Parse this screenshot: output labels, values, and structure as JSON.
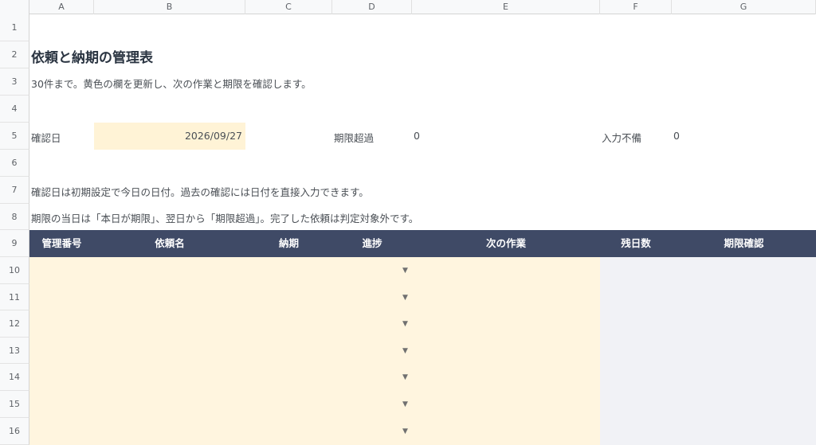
{
  "columns": [
    "A",
    "B",
    "C",
    "D",
    "E",
    "F",
    "G"
  ],
  "rows": [
    "1",
    "2",
    "3",
    "4",
    "5",
    "6",
    "7",
    "8",
    "9",
    "10",
    "11",
    "12",
    "13",
    "14",
    "15",
    "16"
  ],
  "title": "依頼と納期の管理表",
  "subtitle": "30件まで。黄色の欄を更新し、次の作業と期限を確認します。",
  "summary": {
    "check_date_label": "確認日",
    "check_date_value": "2026/09/27",
    "overdue_label": "期限超過",
    "overdue_value": "0",
    "missing_label": "入力不備",
    "missing_value": "0"
  },
  "notes": [
    "確認日は初期設定で今日の日付。過去の確認には日付を直接入力できます。",
    "期限の当日は「本日が期限」、翌日から「期限超過」。完了した依頼は判定対象外です。"
  ],
  "table": {
    "headers": [
      "管理番号",
      "依頼名",
      "納期",
      "進捗",
      "次の作業",
      "残日数",
      "期限確認"
    ],
    "dropdown_glyph": "▼"
  },
  "colors": {
    "header_bg": "#3f4a66",
    "input_yellow": "#fff5df",
    "calc_gray": "#f1f2f6"
  }
}
